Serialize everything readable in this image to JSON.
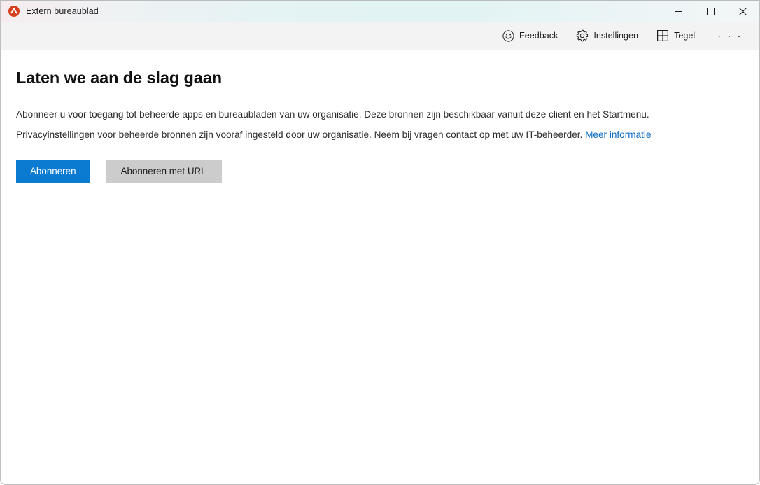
{
  "window": {
    "title": "Extern bureaublad",
    "app_icon": "remote-desktop-icon",
    "controls": {
      "minimize": "minimize-icon",
      "maximize": "maximize-icon",
      "close": "close-icon"
    }
  },
  "toolbar": {
    "items": [
      {
        "label": "Feedback",
        "icon": "smiley-icon"
      },
      {
        "label": "Instellingen",
        "icon": "gear-icon"
      },
      {
        "label": "Tegel",
        "icon": "grid-icon"
      }
    ],
    "overflow_label": "· · ·"
  },
  "main": {
    "heading": "Laten we aan de slag gaan",
    "paragraph_line_1": "Abonneer u voor toegang tot beheerde apps en bureaubladen van uw organisatie. Deze bronnen zijn beschikbaar vanuit deze client en het Startmenu.",
    "paragraph_line_2_before_link": "Privacyinstellingen voor beheerde bronnen zijn vooraf ingesteld door uw organisatie. Neem bij vragen contact op met uw IT-beheerder. ",
    "more_info_link": "Meer informatie",
    "primary_button": "Abonneren",
    "secondary_button": "Abonneren met URL"
  },
  "colors": {
    "accent_blue": "#0b7ad1",
    "link_blue": "#0a6cc4",
    "secondary_button_bg": "#cccccc",
    "toolbar_bg": "#f3f3f3",
    "titlebar_tint": "#e3f3f4",
    "app_icon_red": "#d6401f"
  }
}
